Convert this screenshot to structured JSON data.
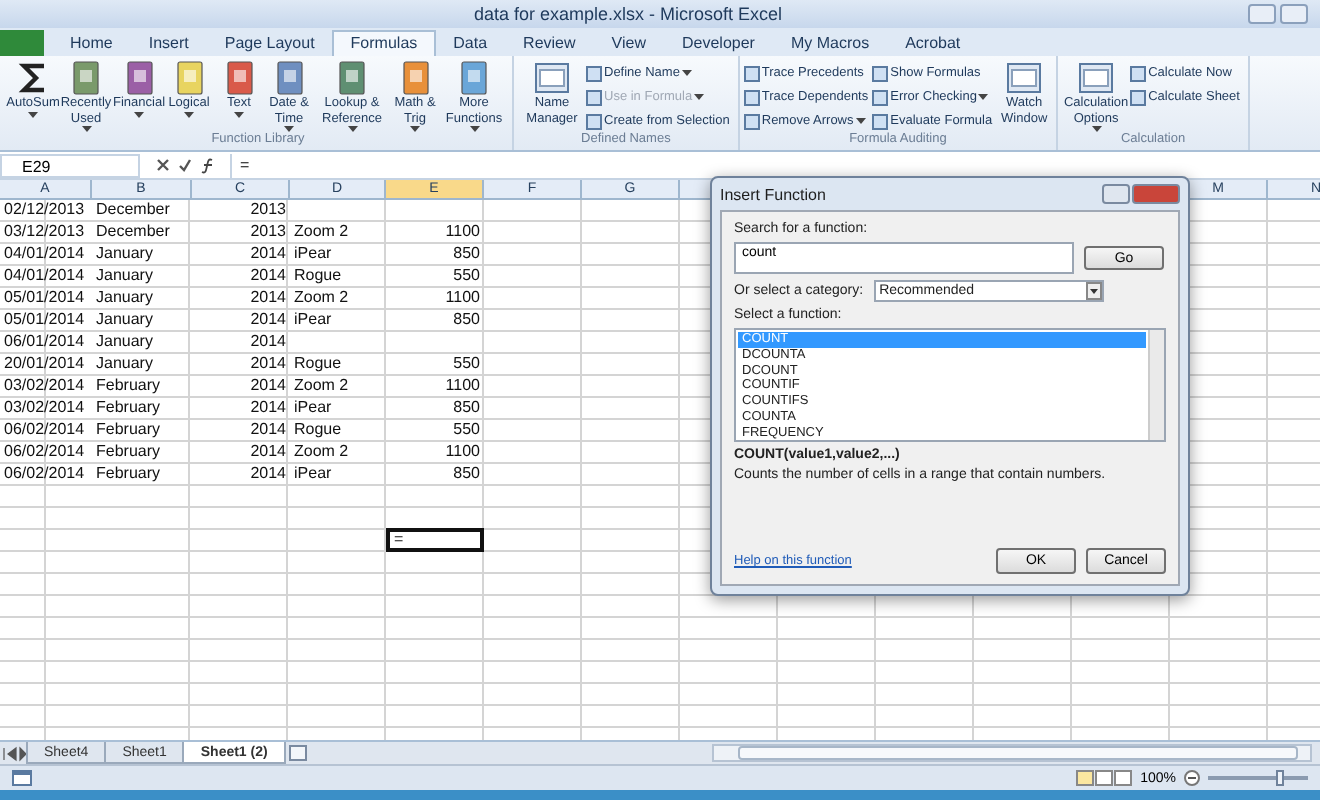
{
  "window": {
    "title": "data for example.xlsx - Microsoft Excel"
  },
  "ribbon_tabs": [
    {
      "label": "Home",
      "selected": false
    },
    {
      "label": "Insert",
      "selected": false
    },
    {
      "label": "Page Layout",
      "selected": false
    },
    {
      "label": "Formulas",
      "selected": true
    },
    {
      "label": "Data",
      "selected": false
    },
    {
      "label": "Review",
      "selected": false
    },
    {
      "label": "View",
      "selected": false
    },
    {
      "label": "Developer",
      "selected": false
    },
    {
      "label": "My Macros",
      "selected": false
    },
    {
      "label": "Acrobat",
      "selected": false
    }
  ],
  "ribbon_groups": [
    {
      "title": "Function Library",
      "kind": "large",
      "items": [
        {
          "label": "AutoSum",
          "dropdown": true
        },
        {
          "label": "Recently Used",
          "dropdown": true
        },
        {
          "label": "Financial",
          "dropdown": true
        },
        {
          "label": "Logical",
          "dropdown": true
        },
        {
          "label": "Text",
          "dropdown": true
        },
        {
          "label": "Date & Time",
          "dropdown": true
        },
        {
          "label": "Lookup & Reference",
          "dropdown": true
        },
        {
          "label": "Math & Trig",
          "dropdown": true
        },
        {
          "label": "More Functions",
          "dropdown": true
        }
      ]
    },
    {
      "title": "Defined Names",
      "kind": "mixed",
      "large": [
        {
          "label": "Name Manager",
          "dropdown": false
        }
      ],
      "columns": [
        [
          {
            "label": "Define Name",
            "dropdown": true,
            "disabled": false
          },
          {
            "label": "Use in Formula",
            "dropdown": true,
            "disabled": true
          },
          {
            "label": "Create from Selection",
            "dropdown": false,
            "disabled": false
          }
        ]
      ]
    },
    {
      "title": "Formula Auditing",
      "kind": "mixed",
      "columns": [
        [
          {
            "label": "Trace Precedents",
            "dropdown": false,
            "disabled": false
          },
          {
            "label": "Trace Dependents",
            "dropdown": false,
            "disabled": false
          },
          {
            "label": "Remove Arrows",
            "dropdown": true,
            "disabled": false
          }
        ],
        [
          {
            "label": "Show Formulas",
            "dropdown": false,
            "disabled": false
          },
          {
            "label": "Error Checking",
            "dropdown": true,
            "disabled": false
          },
          {
            "label": "Evaluate Formula",
            "dropdown": false,
            "disabled": false
          }
        ]
      ],
      "after": [
        {
          "label": "Watch Window",
          "dropdown": false
        }
      ]
    },
    {
      "title": "Calculation",
      "kind": "mixed",
      "large": [
        {
          "label": "Calculation Options",
          "dropdown": true
        }
      ],
      "columns": [
        [
          {
            "label": "Calculate Now",
            "dropdown": false,
            "disabled": false
          },
          {
            "label": "Calculate Sheet",
            "dropdown": false,
            "disabled": false
          }
        ]
      ]
    }
  ],
  "formula_bar": {
    "name_box": "E29",
    "value": "="
  },
  "columns": [
    {
      "label": "A",
      "selected": false
    },
    {
      "label": "B",
      "selected": false
    },
    {
      "label": "C",
      "selected": false
    },
    {
      "label": "D",
      "selected": false
    },
    {
      "label": "E",
      "selected": true
    },
    {
      "label": "F",
      "selected": false
    },
    {
      "label": "G",
      "selected": false
    },
    {
      "label": "M",
      "selected": false
    },
    {
      "label": "N",
      "selected": false
    }
  ],
  "rows": [
    {
      "A": "02/12/2013",
      "B": "December",
      "C": "2013"
    },
    {
      "A": "03/12/2013",
      "B": "December",
      "C": "2013",
      "D": "Zoom 2",
      "E": "1100"
    },
    {
      "A": "04/01/2014",
      "B": "January",
      "C": "2014",
      "D": "iPear",
      "E": "850"
    },
    {
      "A": "04/01/2014",
      "B": "January",
      "C": "2014",
      "D": "Rogue",
      "E": "550"
    },
    {
      "A": "05/01/2014",
      "B": "January",
      "C": "2014",
      "D": "Zoom 2",
      "E": "1100"
    },
    {
      "A": "05/01/2014",
      "B": "January",
      "C": "2014",
      "D": "iPear",
      "E": "850"
    },
    {
      "A": "06/01/2014",
      "B": "January",
      "C": "2014"
    },
    {
      "A": "20/01/2014",
      "B": "January",
      "C": "2014",
      "D": "Rogue",
      "E": "550"
    },
    {
      "A": "03/02/2014",
      "B": "February",
      "C": "2014",
      "D": "Zoom 2",
      "E": "1100"
    },
    {
      "A": "03/02/2014",
      "B": "February",
      "C": "2014",
      "D": "iPear",
      "E": "850"
    },
    {
      "A": "06/02/2014",
      "B": "February",
      "C": "2014",
      "D": "Rogue",
      "E": "550"
    },
    {
      "A": "06/02/2014",
      "B": "February",
      "C": "2014",
      "D": "Zoom 2",
      "E": "1100"
    },
    {
      "A": "06/02/2014",
      "B": "February",
      "C": "2014",
      "D": "iPear",
      "E": "850"
    }
  ],
  "active_cell": {
    "value": "="
  },
  "dialog": {
    "title": "Insert Function",
    "search_label": "Search for a function:",
    "search_value": "count",
    "go": "Go",
    "category_label": "Or select a category:",
    "category": "Recommended",
    "list_label": "Select a function:",
    "functions": [
      {
        "label": "COUNT",
        "selected": true
      },
      {
        "label": "DCOUNTA",
        "selected": false
      },
      {
        "label": "DCOUNT",
        "selected": false
      },
      {
        "label": "COUNTIF",
        "selected": false
      },
      {
        "label": "COUNTIFS",
        "selected": false
      },
      {
        "label": "COUNTA",
        "selected": false
      },
      {
        "label": "FREQUENCY",
        "selected": false
      }
    ],
    "signature": "COUNT(value1,value2,...)",
    "description": "Counts the number of cells in a range that contain numbers.",
    "help_link": "Help on this function",
    "ok": "OK",
    "cancel": "Cancel"
  },
  "sheet_tabs": [
    {
      "label": "Sheet4",
      "selected": false
    },
    {
      "label": "Sheet1",
      "selected": false
    },
    {
      "label": "Sheet1 (2)",
      "selected": true
    }
  ],
  "status_bar": {
    "zoom": "100%",
    "zoom_level": {
      "level": 0.72
    }
  }
}
